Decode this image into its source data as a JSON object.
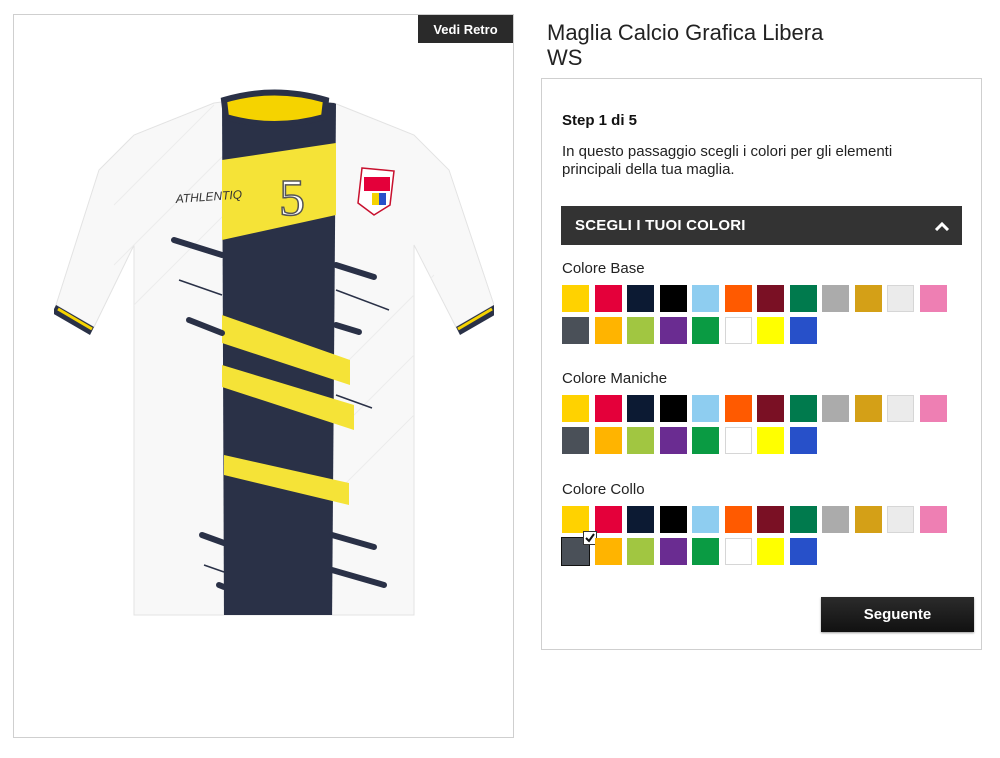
{
  "preview": {
    "back_view_label": "Vedi Retro",
    "brand_text": "ATHLENTIQ",
    "jersey_number": "5"
  },
  "product": {
    "title_line1": "Maglia Calcio Grafica Libera",
    "title_line2": "WS"
  },
  "step": {
    "title": "Step 1 di 5",
    "description": "In questo passaggio scegli i colori per gli elementi principali della tua maglia."
  },
  "colors_section": {
    "label": "SCEGLI I TUOI COLORI"
  },
  "palette": [
    {
      "name": "yellow",
      "hex": "#FFD200"
    },
    {
      "name": "red",
      "hex": "#E4003A"
    },
    {
      "name": "navy",
      "hex": "#0C1A33"
    },
    {
      "name": "black",
      "hex": "#000000"
    },
    {
      "name": "sky",
      "hex": "#8ECDF0"
    },
    {
      "name": "orange",
      "hex": "#FF5A00"
    },
    {
      "name": "burgundy",
      "hex": "#7A1024"
    },
    {
      "name": "green-dark",
      "hex": "#007A4D"
    },
    {
      "name": "grey",
      "hex": "#ABABAB"
    },
    {
      "name": "gold",
      "hex": "#D4A017"
    },
    {
      "name": "light-grey",
      "hex": "#EBEBEB"
    },
    {
      "name": "pink",
      "hex": "#EE7FB3"
    },
    {
      "name": "charcoal",
      "hex": "#4A5058"
    },
    {
      "name": "amber",
      "hex": "#FFB400"
    },
    {
      "name": "lime",
      "hex": "#A1C641"
    },
    {
      "name": "purple",
      "hex": "#6A2C91"
    },
    {
      "name": "green",
      "hex": "#0A9B43"
    },
    {
      "name": "white",
      "hex": "#FFFFFF"
    },
    {
      "name": "bright-yellow",
      "hex": "#FFFF00"
    },
    {
      "name": "royal-blue",
      "hex": "#2750C9"
    }
  ],
  "color_groups": [
    {
      "key": "base",
      "label": "Colore Base",
      "selected_index": null
    },
    {
      "key": "maniche",
      "label": "Colore Maniche",
      "selected_index": null
    },
    {
      "key": "collo",
      "label": "Colore Collo",
      "selected_index": 12
    }
  ],
  "next_button": {
    "label": "Seguente"
  },
  "icons": {
    "accordion": "chevron-up-icon",
    "selected": "check-icon"
  }
}
